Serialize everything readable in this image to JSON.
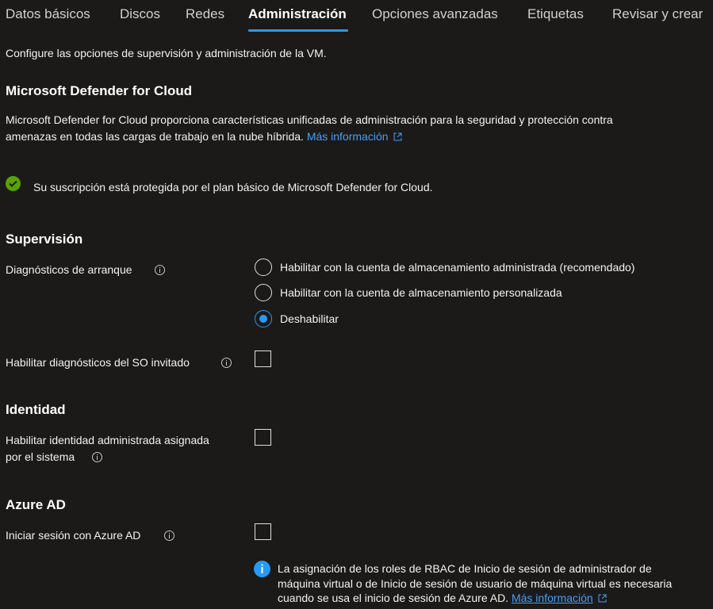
{
  "tabs": [
    {
      "label": "Datos básicos",
      "active": false
    },
    {
      "label": "Discos",
      "active": false
    },
    {
      "label": "Redes",
      "active": false
    },
    {
      "label": "Administración",
      "active": true
    },
    {
      "label": "Opciones avanzadas",
      "active": false
    },
    {
      "label": "Etiquetas",
      "active": false
    },
    {
      "label": "Revisar y crear",
      "active": false
    }
  ],
  "intro": "Configure las opciones de supervisión y administración de la VM.",
  "defender": {
    "heading": "Microsoft Defender for Cloud",
    "description_line1": "Microsoft Defender for Cloud proporciona características unificadas de administración para la seguridad y protección contra",
    "description_line2": "amenazas en todas las cargas de trabajo en la nube híbrida.",
    "learn_more": "Más información",
    "status_text": "Su suscripción está protegida por el plan básico de Microsoft Defender for Cloud.",
    "status_color": "#57a300"
  },
  "monitoring": {
    "heading": "Supervisión",
    "boot_diagnostics": {
      "label": "Diagnósticos de arranque",
      "options": [
        {
          "label": "Habilitar con la cuenta de almacenamiento administrada (recomendado)",
          "selected": false
        },
        {
          "label": "Habilitar con la cuenta de almacenamiento personalizada",
          "selected": false
        },
        {
          "label": "Deshabilitar",
          "selected": true
        }
      ]
    },
    "guest_os": {
      "label": "Habilitar diagnósticos del SO invitado",
      "checked": false
    }
  },
  "identity": {
    "heading": "Identidad",
    "managed_identity_line1": "Habilitar identidad administrada asignada",
    "managed_identity_line2": "por el sistema",
    "checked": false
  },
  "azure_ad": {
    "heading": "Azure AD",
    "login_label": "Iniciar sesión con Azure AD",
    "checked": false,
    "note_line1": "La asignación de los roles de RBAC de Inicio de sesión de administrador de",
    "note_line2": "máquina virtual o de Inicio de sesión de usuario de máquina virtual es necesaria",
    "note_line3": "cuando se usa el inicio de sesión de Azure AD.",
    "learn_more": "Más información"
  },
  "colors": {
    "accent": "#2899f5",
    "link": "#479ef5",
    "background": "#1b1a19"
  }
}
